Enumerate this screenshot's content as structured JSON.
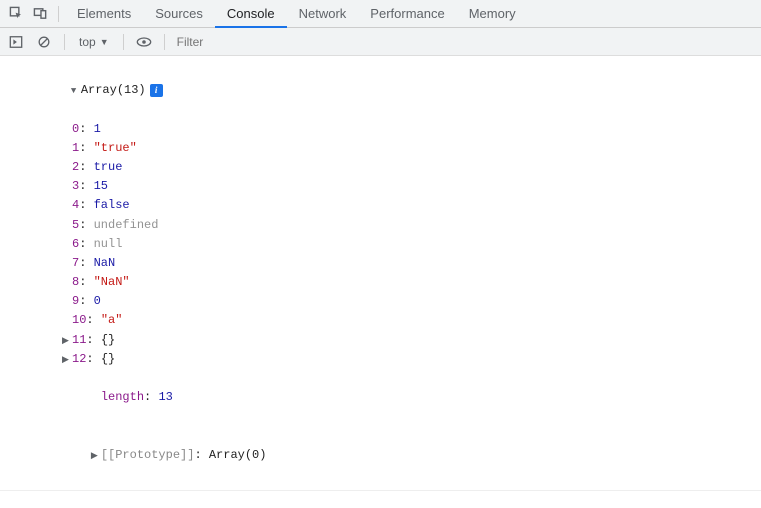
{
  "tabs": {
    "elements": "Elements",
    "sources": "Sources",
    "console": "Console",
    "network": "Network",
    "performance": "Performance",
    "memory": "Memory"
  },
  "toolbar": {
    "context": "top",
    "filter_placeholder": "Filter"
  },
  "object": {
    "header": "Array(13)",
    "info_badge": "i",
    "entries": [
      {
        "key": "0",
        "display": "1",
        "type": "num"
      },
      {
        "key": "1",
        "display": "\"true\"",
        "type": "str"
      },
      {
        "key": "2",
        "display": "true",
        "type": "bool"
      },
      {
        "key": "3",
        "display": "15",
        "type": "num"
      },
      {
        "key": "4",
        "display": "false",
        "type": "bool"
      },
      {
        "key": "5",
        "display": "undefined",
        "type": "undef"
      },
      {
        "key": "6",
        "display": "null",
        "type": "null"
      },
      {
        "key": "7",
        "display": "NaN",
        "type": "num"
      },
      {
        "key": "8",
        "display": "\"NaN\"",
        "type": "str"
      },
      {
        "key": "9",
        "display": "0",
        "type": "num"
      },
      {
        "key": "10",
        "display": "\"a\"",
        "type": "str"
      },
      {
        "key": "11",
        "display": "{}",
        "type": "obj",
        "expandable": true
      },
      {
        "key": "12",
        "display": "{}",
        "type": "obj",
        "expandable": true
      }
    ],
    "length_key": "length",
    "length_val": "13",
    "proto_key": "[[Prototype]]",
    "proto_val": "Array(0)"
  }
}
